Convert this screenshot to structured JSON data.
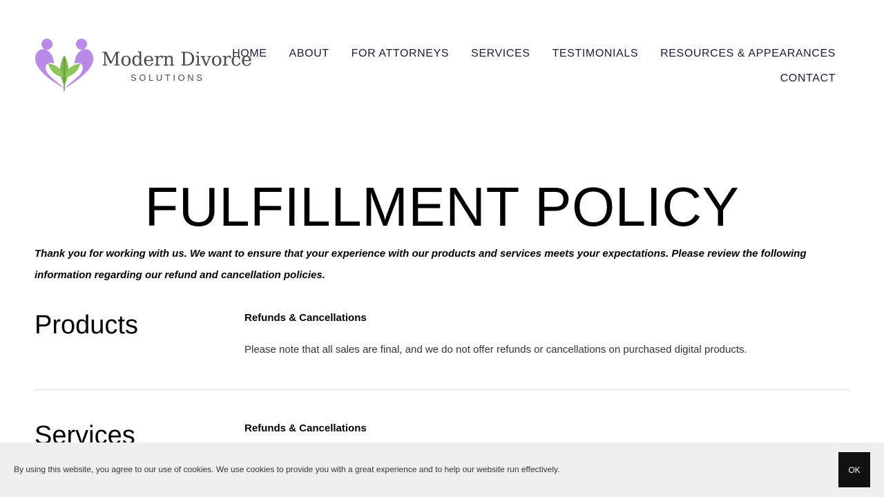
{
  "header": {
    "logo": {
      "name": "Modern Divorce",
      "subtitle": "SOLUTIONS"
    },
    "nav": {
      "row1": [
        "HOME",
        "ABOUT",
        "FOR ATTORNEYS",
        "SERVICES",
        "TESTIMONIALS",
        "RESOURCES & APPEARANCES"
      ],
      "row2": [
        "CONTACT"
      ]
    }
  },
  "main": {
    "title": "FULFILLMENT POLICY",
    "intro": "Thank you for working with us. We want to ensure that your experience with our products and services meets your expectations. Please review the following information regarding our refund and cancellation policies.",
    "sections": [
      {
        "heading": "Products",
        "subheading": "Refunds & Cancellations",
        "body": "Please note that all sales are final, and we do not offer refunds or cancellations on purchased digital products."
      },
      {
        "heading": "Services",
        "subheading": "Refunds & Cancellations"
      }
    ]
  },
  "cookie_banner": {
    "text": "By using this website, you agree to our use of cookies. We use cookies to provide you with a great experience and to help our website run effectively.",
    "ok_label": "OK"
  },
  "colors": {
    "logo_purple": "#b98ae8",
    "logo_green": "#7db84a",
    "nav_text": "#1f1a3a",
    "banner_bg": "#efefef",
    "button_bg": "#111111"
  }
}
